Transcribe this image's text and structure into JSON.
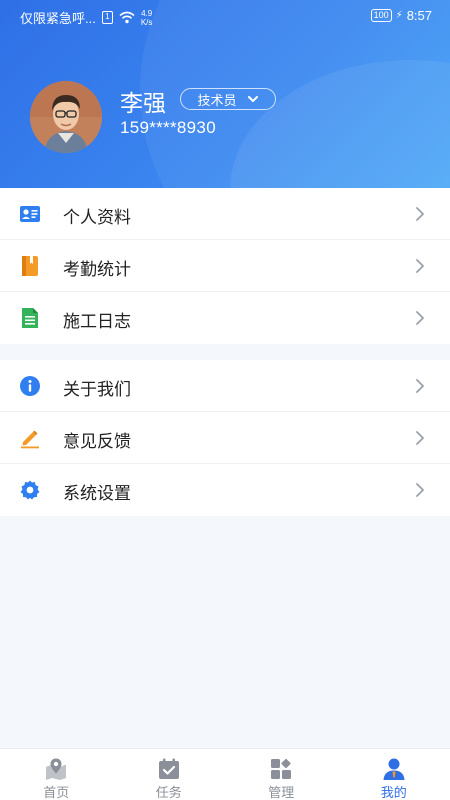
{
  "status_bar": {
    "notice": "仅限紧急呼...",
    "speed_value": "4.9",
    "speed_unit": "K/s",
    "battery": "100",
    "time": "8:57"
  },
  "profile": {
    "name": "李强",
    "role": "技术员",
    "phone": "159****8930"
  },
  "menu_group_1": [
    {
      "label": "个人资料",
      "icon": "id-card-icon"
    },
    {
      "label": "考勤统计",
      "icon": "attendance-book-icon"
    },
    {
      "label": "施工日志",
      "icon": "log-document-icon"
    }
  ],
  "menu_group_2": [
    {
      "label": "关于我们",
      "icon": "info-icon"
    },
    {
      "label": "意见反馈",
      "icon": "pencil-icon"
    },
    {
      "label": "系统设置",
      "icon": "gear-icon"
    }
  ],
  "tabbar": {
    "tabs": [
      {
        "label": "首页",
        "icon": "map-pin-icon",
        "active": false
      },
      {
        "label": "任务",
        "icon": "task-calendar-icon",
        "active": false
      },
      {
        "label": "管理",
        "icon": "grid-icon",
        "active": false
      },
      {
        "label": "我的",
        "icon": "user-icon",
        "active": true
      }
    ]
  },
  "colors": {
    "brand": "#2f6fe6",
    "header_gradient_end": "#43a3f7",
    "inactive_tab": "#8a8f99"
  }
}
